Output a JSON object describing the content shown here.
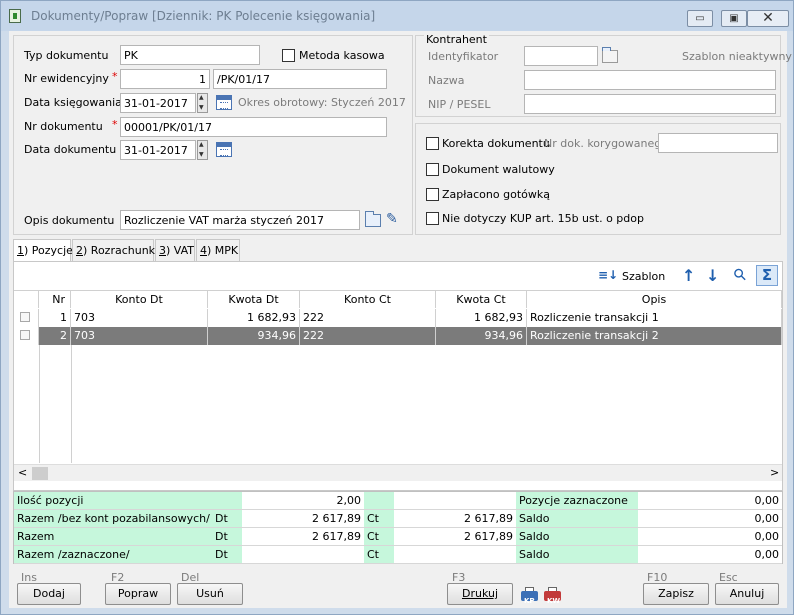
{
  "window": {
    "title": "Dokumenty/Popraw [Dziennik: PK  Polecenie księgowania]",
    "minimize": "▭",
    "maximize": "▣",
    "close": "✕"
  },
  "form": {
    "typ_label": "Typ dokumentu",
    "typ_value": "PK",
    "metoda_label": "Metoda kasowa",
    "nr_ewid_label": "Nr ewidencyjny",
    "nr_ewid_num": "1",
    "nr_ewid_suffix": "/PK/01/17",
    "data_ksieg_label": "Data księgowania",
    "data_ksieg_value": "31-01-2017",
    "okres_text": "Okres obrotowy: Styczeń 2017",
    "nr_dok_label": "Nr dokumentu",
    "nr_dok_value": "00001/PK/01/17",
    "data_dok_label": "Data dokumentu",
    "data_dok_value": "31-01-2017",
    "opis_label": "Opis dokumentu",
    "opis_value": "Rozliczenie VAT marża styczeń 2017",
    "req_mark": "*"
  },
  "kontrahent": {
    "title": "Kontrahent",
    "id_label": "Identyfikator",
    "id_value": "",
    "szablon_text": "Szablon nieaktywny",
    "nazwa_label": "Nazwa",
    "nazwa_value": "",
    "nip_label": "NIP / PESEL",
    "nip_value": ""
  },
  "options": {
    "korekta_label": "Korekta dokumentu",
    "nr_kor_label": "Nr dok. korygowanego",
    "nr_kor_value": "",
    "walutowy_label": "Dokument walutowy",
    "gotowka_label": "Zapłacono gotówką",
    "kup_label": "Nie dotyczy KUP art. 15b ust. o pdop"
  },
  "tabs": [
    {
      "key": "1",
      "label": " Pozycje"
    },
    {
      "key": "2",
      "label": " Rozrachunki"
    },
    {
      "key": "3",
      "label": " VAT"
    },
    {
      "key": "4",
      "label": " MPK"
    }
  ],
  "toolbar": {
    "szablon_label": "Szablon",
    "szablon_icon": "≡↓",
    "up_icon": "↑",
    "down_icon": "↓",
    "search_icon": "⚲",
    "sigma_icon": "Σ"
  },
  "grid": {
    "headers": [
      "Nr",
      "Konto Dt",
      "Kwota Dt",
      "Konto Ct",
      "Kwota Ct",
      "Opis"
    ],
    "rows": [
      {
        "nr": "1",
        "konto_dt": "703",
        "kwota_dt": "1 682,93",
        "konto_ct": "222",
        "kwota_ct": "1 682,93",
        "opis": "Rozliczenie transakcji 1"
      },
      {
        "nr": "2",
        "konto_dt": "703",
        "kwota_dt": "934,96",
        "konto_ct": "222",
        "kwota_ct": "934,96",
        "opis": "Rozliczenie transakcji 2"
      }
    ],
    "scroll_left": "<",
    "scroll_right": ">"
  },
  "summary": {
    "ilosc_label": "Ilość pozycji",
    "ilosc_value": "2,00",
    "razem_bez_label": "Razem /bez kont pozabilansowych/",
    "razem_label": "Razem",
    "razem_zazn_label": "Razem /zaznaczone/",
    "dt": "Dt",
    "ct": "Ct",
    "razem_bez_dt": "2 617,89",
    "razem_bez_ct": "2 617,89",
    "razem_dt": "2 617,89",
    "razem_ct": "2 617,89",
    "razem_zazn_dt": "",
    "razem_zazn_ct": "",
    "poz_zazn_label": "Pozycje zaznaczone",
    "saldo_label": "Saldo",
    "poz_zazn_value": "0,00",
    "saldo1_value": "0,00",
    "saldo2_value": "0,00",
    "saldo3_value": "0,00"
  },
  "buttons": {
    "ins_key": "Ins",
    "dodaj": "Dodaj",
    "f2_key": "F2",
    "popraw": "Popraw",
    "del_key": "Del",
    "usun": "Usuń",
    "f3_key": "F3",
    "drukuj": "Drukuj",
    "kp_tag": "KP",
    "kw_tag": "KW",
    "f10_key": "F10",
    "zapisz": "Zapisz",
    "esc_key": "Esc",
    "anuluj": "Anuluj"
  }
}
